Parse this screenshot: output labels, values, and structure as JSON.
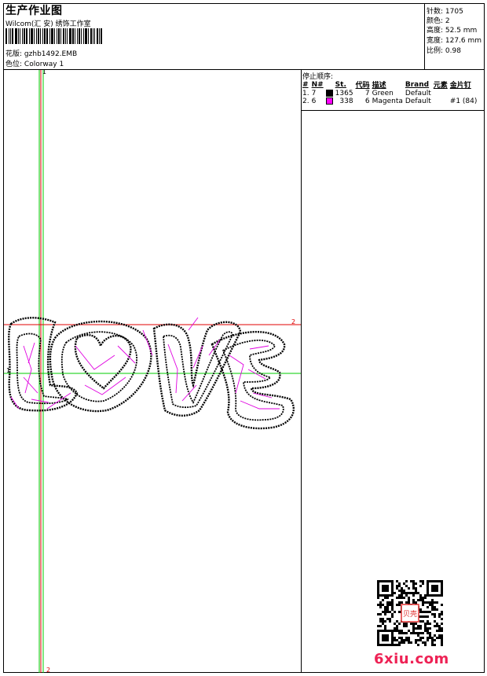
{
  "header": {
    "title": "生产作业图",
    "company": "Wilcom(汇 安) 绣饰工作室",
    "design_label": "花版:",
    "design_file": "gzhb1492.EMB",
    "colorway_label": "色位:",
    "colorway_value": "Colorway 1"
  },
  "stats": {
    "stitches": "针数: 1705",
    "colors": "颜色: 2",
    "height": "高度: 52.5 mm",
    "width": "宽度: 127.6 mm",
    "scale": "比例: 0.98"
  },
  "stop_sequence": {
    "title": "停止顺序:",
    "columns": [
      "#",
      "N#",
      "St.",
      "代码",
      "描述",
      "Brand",
      "元素",
      "金片钉"
    ],
    "rows": [
      {
        "index": "1.",
        "needle": "7",
        "color": "#000000",
        "stitches": "1365",
        "code": "7",
        "description": "Green",
        "brand": "Default",
        "element": "",
        "sequin": ""
      },
      {
        "index": "2.",
        "needle": "6",
        "color": "#ff00ff",
        "stitches": "338",
        "code": "6",
        "description": "Magenta",
        "brand": "Default",
        "element": "",
        "sequin": "#1 (84)"
      }
    ]
  },
  "guides": {
    "vertical_start": "1",
    "vertical_end": "2",
    "horizontal_left": "1",
    "horizontal_right": "2"
  },
  "watermark": "6xiu.com",
  "qr_stamp": "贝壳"
}
